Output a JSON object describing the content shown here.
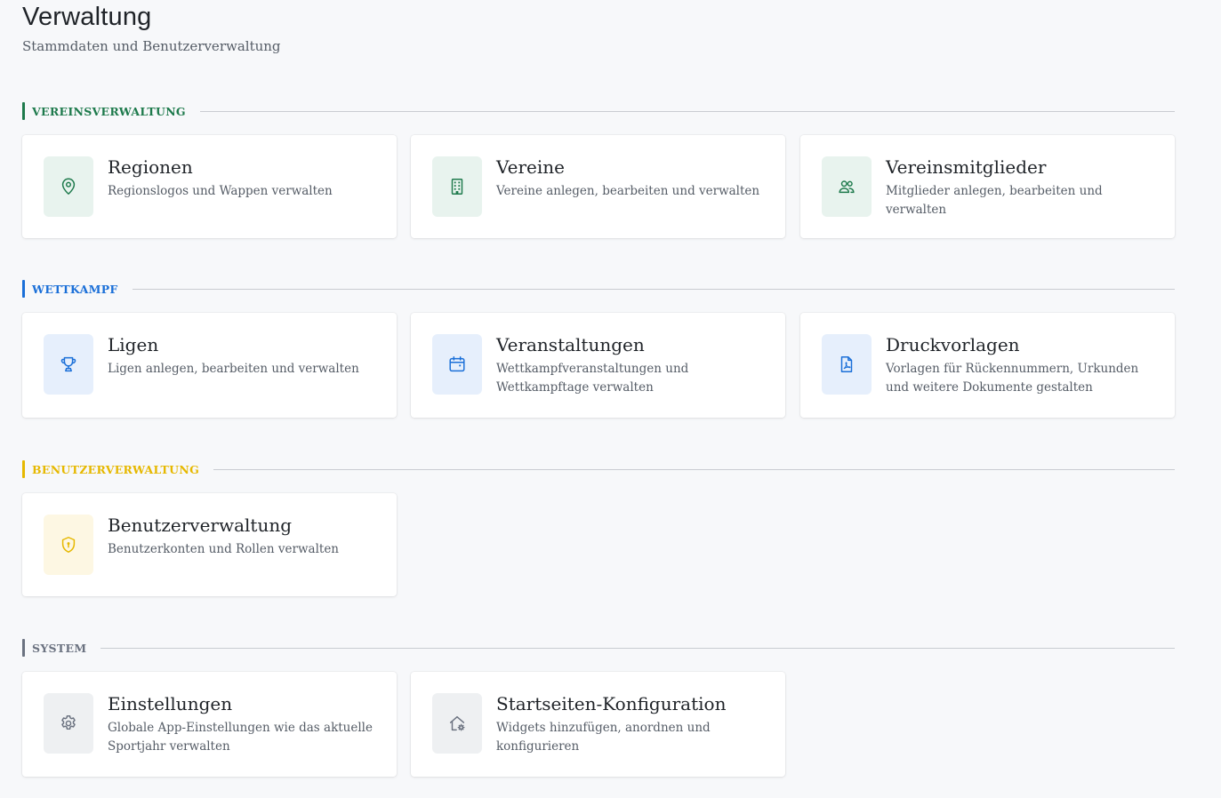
{
  "header": {
    "title": "Verwaltung",
    "subtitle": "Stammdaten und Benutzerverwaltung"
  },
  "colors": {
    "green": "#1e7a4c",
    "blue": "#1a6fd8",
    "yellow": "#e6b800",
    "gray": "#6b7280"
  },
  "sections": [
    {
      "label": "VEREINSVERWALTUNG",
      "cards": [
        {
          "title": "Regionen",
          "description": "Regionslogos und Wappen verwalten",
          "icon": "map-pin-icon"
        },
        {
          "title": "Vereine",
          "description": "Vereine anlegen, bearbeiten und verwalten",
          "icon": "building-icon"
        },
        {
          "title": "Vereinsmitglieder",
          "description": "Mitglieder anlegen, bearbeiten und verwalten",
          "icon": "users-icon"
        }
      ]
    },
    {
      "label": "WETTKAMPF",
      "cards": [
        {
          "title": "Ligen",
          "description": "Ligen anlegen, bearbeiten und verwalten",
          "icon": "trophy-icon"
        },
        {
          "title": "Veranstaltungen",
          "description": "Wettkampfveranstaltungen und Wettkampftage verwalten",
          "icon": "calendar-icon"
        },
        {
          "title": "Druckvorlagen",
          "description": "Vorlagen für Rückennummern, Urkunden und weitere Dokumente gestalten",
          "icon": "pdf-file-icon"
        }
      ]
    },
    {
      "label": "BENUTZERVERWALTUNG",
      "cards": [
        {
          "title": "Benutzerverwaltung",
          "description": "Benutzerkonten und Rollen verwalten",
          "icon": "shield-lock-icon"
        }
      ]
    },
    {
      "label": "SYSTEM",
      "cards": [
        {
          "title": "Einstellungen",
          "description": "Globale App-Einstellungen wie das aktuelle Sportjahr verwalten",
          "icon": "gear-icon"
        },
        {
          "title": "Startseiten-Konfiguration",
          "description": "Widgets hinzufügen, anordnen und konfigurieren",
          "icon": "home-gear-icon"
        }
      ]
    }
  ]
}
